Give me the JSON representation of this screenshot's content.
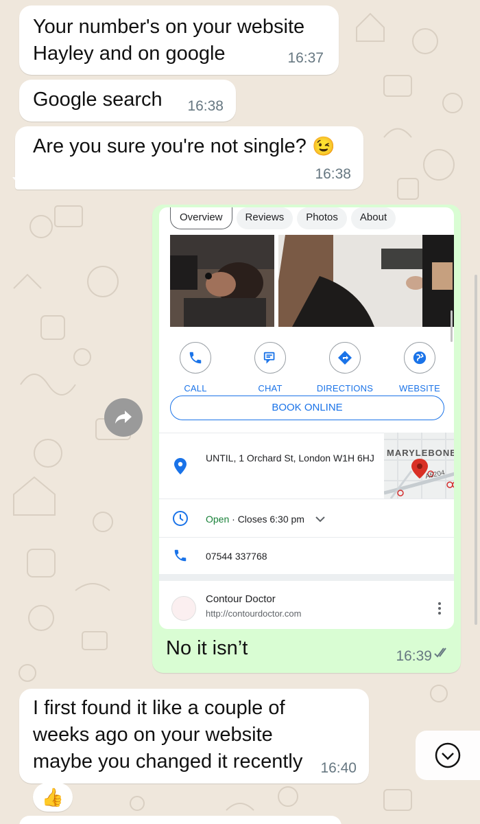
{
  "messages": {
    "m1": {
      "text": "Your number's on your website Hayley and on google",
      "time": "16:37"
    },
    "m2": {
      "text": "Google search",
      "time": "16:38"
    },
    "m3": {
      "text": "Are you sure you're not single?",
      "emoji": "😉",
      "time": "16:38"
    },
    "m4": {
      "caption": "No it isn’t",
      "time": "16:39"
    },
    "m5": {
      "text": "I first found it like a couple of weeks ago on your website maybe you changed it recently",
      "time": "16:40",
      "reaction": "👍"
    }
  },
  "shot": {
    "tabs": [
      "Overview",
      "Reviews",
      "Photos",
      "About"
    ],
    "actions": {
      "call": "CALL",
      "chat": "CHAT",
      "directions": "DIRECTIONS",
      "website": "WEBSITE"
    },
    "book": "BOOK ONLINE",
    "address": "UNTIL, 1 Orchard St, London W1H 6HJ",
    "map_label": "MARYLEBONE",
    "map_road": "A5204",
    "hours_open": "Open",
    "hours_close": " · Closes 6:30 pm",
    "phone": "07544 337768",
    "site_name": "Contour Doctor",
    "site_url": "http://contourdoctor.com"
  },
  "colors": {
    "accent": "#1a73e8",
    "open_green": "#188038",
    "outgoing": "#d9fdd3",
    "incoming": "#ffffff",
    "wallpaper": "#efe7dc"
  },
  "icons": [
    "forward-icon",
    "phone-icon",
    "chat-icon",
    "directions-icon",
    "globe-icon",
    "location-pin-icon",
    "clock-icon",
    "chevron-down-icon",
    "kebab-icon",
    "read-ticks-icon",
    "scroll-down-icon",
    "thumbs-up-emoji"
  ]
}
